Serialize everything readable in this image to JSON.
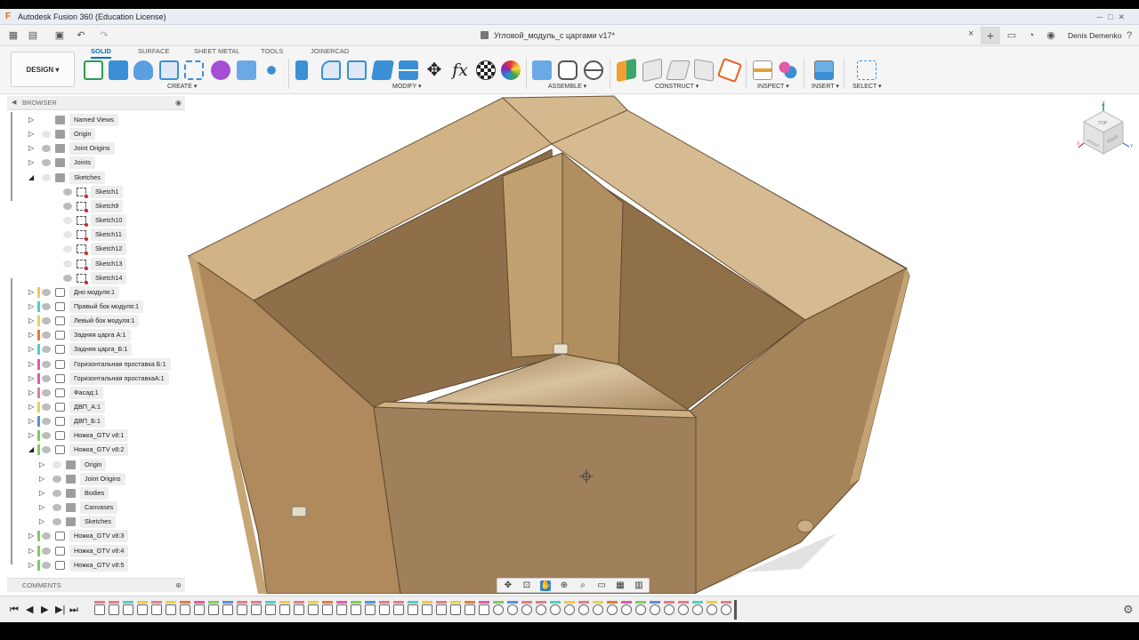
{
  "window": {
    "title": "Autodesk Fusion 360 (Education License)",
    "logo": "F"
  },
  "tabbar": {
    "document_title": "Угловой_модуль_с царгами v17*",
    "user": "Denis Demenko",
    "close": "×",
    "add": "+"
  },
  "toolbar": {
    "workspace": "DESIGN ▾",
    "tabs": [
      "SOLID",
      "SURFACE",
      "SHEET METAL",
      "TOOLS",
      "JOINERCAD"
    ],
    "groups": [
      "CREATE ▾",
      "MODIFY ▾",
      "ASSEMBLE ▾",
      "CONSTRUCT ▾",
      "INSPECT ▾",
      "INSERT ▾",
      "SELECT ▾"
    ]
  },
  "browser": {
    "header": "BROWSER",
    "comments": "COMMENTS",
    "items": [
      {
        "label": "Named Views",
        "icon": "folder-icon"
      },
      {
        "label": "Origin",
        "icon": "folder-icon"
      },
      {
        "label": "Joint Origins",
        "icon": "folder-icon"
      },
      {
        "label": "Joints",
        "icon": "folder-icon"
      },
      {
        "label": "Sketches",
        "icon": "folder-icon"
      },
      {
        "label": "Sketch1",
        "icon": "sketch-icon"
      },
      {
        "label": "Sketch9",
        "icon": "sketch-icon"
      },
      {
        "label": "Sketch10",
        "icon": "sketch-icon"
      },
      {
        "label": "Sketch11",
        "icon": "sketch-icon"
      },
      {
        "label": "Sketch12",
        "icon": "sketch-icon"
      },
      {
        "label": "Sketch13",
        "icon": "sketch-icon"
      },
      {
        "label": "Sketch14",
        "icon": "sketch-icon"
      },
      {
        "label": "Дно модуля:1",
        "icon": "component-icon",
        "color": "#f2c94c"
      },
      {
        "label": "Правый бок модуля:1",
        "icon": "component-icon",
        "color": "#4dd0c8"
      },
      {
        "label": "Левый бок модуля:1",
        "icon": "component-icon",
        "color": "#e5d34a"
      },
      {
        "label": "Задняя царга А:1",
        "icon": "component-icon",
        "color": "#e57c3a"
      },
      {
        "label": "Задняя царга_Б:1",
        "icon": "component-icon",
        "color": "#4dd0c8"
      },
      {
        "label": "Горизонтальная проставка Б:1",
        "icon": "component-icon",
        "color": "#e35aa8"
      },
      {
        "label": "Горизонтальная проставкаА:1",
        "icon": "component-icon",
        "color": "#e35aa8"
      },
      {
        "label": "Фасад:1",
        "icon": "component-icon",
        "color": "#e57c8a"
      },
      {
        "label": "ДВП_А:1",
        "icon": "component-icon",
        "color": "#e5d34a"
      },
      {
        "label": "ДВП_Б:1",
        "icon": "component-icon",
        "color": "#5b8fd6"
      },
      {
        "label": "Ножка_GTV v8:1",
        "icon": "component-icon",
        "color": "#7ccf5a"
      },
      {
        "label": "Ножка_GTV v8:2",
        "icon": "component-icon",
        "color": "#7ccf5a"
      },
      {
        "label": "Origin",
        "icon": "folder-icon"
      },
      {
        "label": "Joint Origins",
        "icon": "folder-icon"
      },
      {
        "label": "Bodies",
        "icon": "folder-icon"
      },
      {
        "label": "Canvases",
        "icon": "folder-icon"
      },
      {
        "label": "Sketches",
        "icon": "folder-icon"
      },
      {
        "label": "Ножка_GTV v8:3",
        "icon": "component-icon",
        "color": "#7ccf5a"
      },
      {
        "label": "Ножка_GTV v8:4",
        "icon": "component-icon",
        "color": "#7ccf5a"
      },
      {
        "label": "Ножка_GTV v8:5",
        "icon": "component-icon",
        "color": "#7ccf5a"
      }
    ]
  },
  "viewcube": {
    "top": "TOP",
    "front": "FRONT",
    "right": "RIGHT"
  },
  "navbar": {
    "icons": [
      "orbit-icon",
      "look-at-icon",
      "pan-icon",
      "zoom-window-icon",
      "zoom-icon",
      "display-settings-icon",
      "grid-icon",
      "viewports-icon"
    ]
  },
  "timeline": {
    "controls": [
      "⏮",
      "◀",
      "▶",
      "▶|",
      "⏭"
    ],
    "settings": "⚙"
  },
  "colors": {
    "accent": "#0a6fbd",
    "wood": "#c9a979",
    "wood_dark": "#a4825a",
    "wood_light": "#dcc29a"
  }
}
